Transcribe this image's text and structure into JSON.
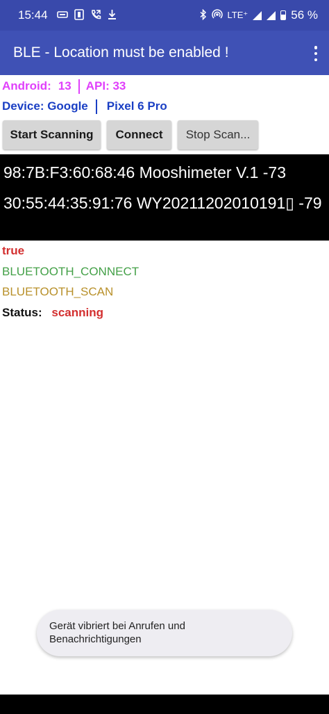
{
  "status_bar": {
    "time": "15:44",
    "lte": "LTE⁺",
    "battery": "56 %"
  },
  "app_bar": {
    "title": "BLE - Location must be enabled !"
  },
  "info": {
    "android_label": "Android:",
    "android_version": "13",
    "api_label": "API: 33",
    "device_label": "Device: Google",
    "device_model": "Pixel 6 Pro"
  },
  "buttons": {
    "start": "Start Scanning",
    "connect": "Connect",
    "stop": "Stop Scan..."
  },
  "devices": [
    {
      "text": "98:7B:F3:60:68:46 Mooshimeter V.1 -73"
    },
    {
      "text": "30:55:44:35:91:76 WY20211202010191▯ -79"
    }
  ],
  "status_lines": {
    "enabled": "true",
    "perm_connect": "BLUETOOTH_CONNECT",
    "perm_scan": "BLUETOOTH_SCAN",
    "status_label": "Status:",
    "status_value": "scanning"
  },
  "toast": {
    "line1": "Gerät vibriert bei Anrufen und",
    "line2": "Benachrichtigungen"
  },
  "colors": {
    "status_bar": "#3949ab",
    "app_bar": "#3f51b5",
    "android_text": "#e040fb",
    "device_text": "#1a3fc4",
    "true_text": "#d32f2f",
    "connect_text": "#43a047",
    "scan_text": "#b8902a"
  },
  "icons": {
    "status_left": [
      "debug-icon",
      "nfc-icon",
      "call-forward-icon",
      "download-icon"
    ],
    "status_right": [
      "bluetooth-icon",
      "hotspot-icon",
      "signal-icon",
      "battery-icon"
    ],
    "app_bar": [
      "overflow-menu-icon"
    ]
  }
}
